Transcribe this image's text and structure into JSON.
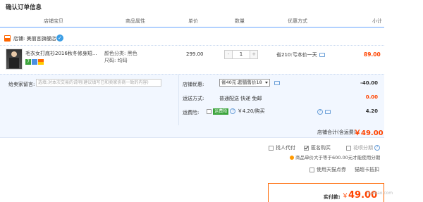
{
  "page_title": "确认订单信息",
  "columns": [
    "店铺宝贝",
    "商品属性",
    "单价",
    "数量",
    "优惠方式",
    "小计"
  ],
  "shop": {
    "label": "店铺: 美丽言旗舰店"
  },
  "item": {
    "name": "毛衣女打底衫2016秋冬修身短...",
    "badge_text": "7",
    "color_attr": "颜色分类: 黑色",
    "size_attr": "尺码: 均码",
    "price": "299.00",
    "quantity": "1",
    "qty_minus": "-",
    "qty_plus": "+",
    "discount": "省210:亏本价一天",
    "subtotal": "89.00"
  },
  "message": {
    "label": "给卖家留言:",
    "placeholder": "选填:对本次交易的说明(建议填写已和卖家协商一致的内容)"
  },
  "shop_discount": {
    "label": "店铺优惠:",
    "selected": "省40元:超值售价18",
    "amount": "-40.00"
  },
  "shipping": {
    "label": "运送方式:",
    "method": "普通配送 快递 免邮",
    "amount": "0.00"
  },
  "insurance": {
    "label": "运费险:",
    "tag": "运费险",
    "text": "￥4.20/购买",
    "help": "?",
    "amount": "4.20"
  },
  "shop_total": {
    "label": "店铺合计(含运费)",
    "amount": "￥49.00"
  },
  "options": {
    "proxy": "找人代付",
    "anonymous": "匿名购买",
    "installment": "花呗分期",
    "installment_note": "商品单价大于等于600.00元才能使用分期",
    "tmall_points": "使用天猫点券",
    "tmall_points_value": "猫超卡抵扣"
  },
  "confirm": {
    "label": "实付款:",
    "currency": "￥",
    "amount": "49.00"
  },
  "watermark": "huabao.com"
}
